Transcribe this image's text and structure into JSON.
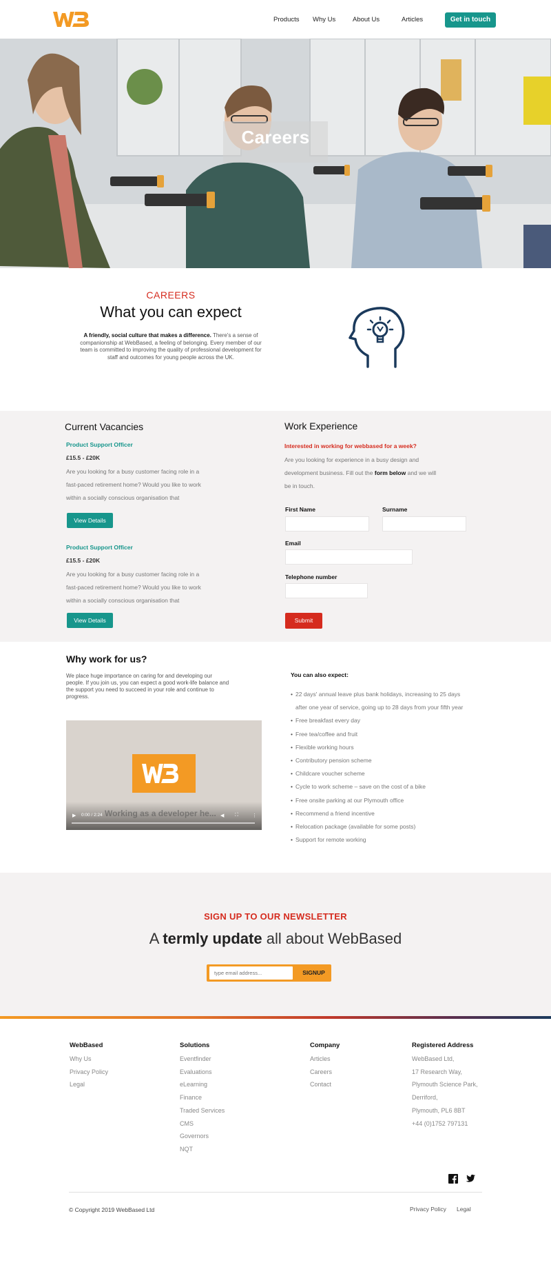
{
  "header": {
    "logo_text": "WB",
    "nav": [
      "Products",
      "Why Us",
      "About Us",
      "Articles"
    ],
    "cta_label": "Get in touch"
  },
  "hero": {
    "title": "Careers"
  },
  "expect": {
    "kicker": "CAREERS",
    "title": "What you can expect",
    "body_bold": "A friendly, social culture that makes a difference.",
    "body_rest": " There's a sense of companionship at WebBased, a feeling of belonging. Every member of our team is committed to improving the quality of professional development for staff and outcomes for young people across the UK.",
    "icon": "head-lightbulb-icon"
  },
  "vacancies": {
    "title": "Current Vacancies",
    "jobs": [
      {
        "title": "Product Support Officer",
        "salary": "£15.5 - £20K",
        "description": "Are you looking for a busy customer facing role in a fast-paced retirement home? Would you like to work within a socially conscious organisation that",
        "button": "View Details"
      },
      {
        "title": "Product Support Officer",
        "salary": "£15.5 - £20K",
        "description": "Are you looking for a busy customer facing role in a fast-paced retirement home? Would you like to work within a socially conscious organisation that",
        "button": "View Details"
      }
    ]
  },
  "work_experience": {
    "title": "Work Experience",
    "lead": "Interested in working for webbased for a week?",
    "body_1": "Are you looking for experience in a busy design and development business. Fill out the ",
    "body_bold": "form below",
    "body_2": " and we will be in touch.",
    "fields": {
      "first_name": "First Name",
      "surname": "Surname",
      "email": "Email",
      "telephone": "Telephone number"
    },
    "submit": "Submit"
  },
  "why": {
    "title": "Why work for us?",
    "body": "We place huge importance on caring for and developing our people. If you join us, you can expect a good work-life balance and the support you need to succeed in your role and continue to progress.",
    "video": {
      "logo_text": "WB",
      "overlay_text": "Working as a developer he...",
      "time": "0:00 / 2:24"
    },
    "also_title": "You can also expect:",
    "also_items": [
      "22 days' annual leave plus bank holidays, increasing to 25 days after one year of service, going up to 28 days from your fifth year",
      "Free breakfast every day",
      "Free tea/coffee and fruit",
      "Flexible working hours",
      "Contributory pension scheme",
      "Childcare voucher scheme",
      "Cycle to work scheme – save on the cost of a bike",
      "Free onsite parking at our Plymouth office",
      "Recommend a friend incentive",
      "Relocation package (available for some posts)",
      "Support for remote working"
    ]
  },
  "newsletter": {
    "kicker": "SIGN UP TO OUR NEWSLETTER",
    "title_1": "A ",
    "title_bold": "termly update",
    "title_2": " all about WebBased",
    "placeholder": "type email address...",
    "button": "SIGNUP"
  },
  "footer": {
    "columns": [
      {
        "title": "WebBased",
        "items": [
          "Why Us",
          "Privacy Policy",
          "Legal"
        ]
      },
      {
        "title": "Solutions",
        "items": [
          "Eventfinder",
          "Evaluations",
          "eLearning",
          "Finance",
          "Traded Services",
          "CMS",
          "Governors",
          "NQT"
        ]
      },
      {
        "title": "Company",
        "items": [
          "Articles",
          "Careers",
          "Contact"
        ]
      },
      {
        "title": "Registered Address",
        "items": [
          "WebBased Ltd,",
          "17 Research Way,",
          "Plymouth Science Park,",
          "Derriford,",
          "Plymouth, PL6 8BT",
          "+44 (0)1752 797131"
        ]
      }
    ],
    "social": [
      "facebook-icon",
      "twitter-icon"
    ],
    "copyright": "© Copyright 2019 WebBased Ltd",
    "legal_links": [
      "Privacy Policy",
      "Legal"
    ]
  },
  "colors": {
    "brand_orange": "#f39a24",
    "teal": "#17968c",
    "red": "#d52b1e",
    "band_grey": "#f4f2f2"
  }
}
